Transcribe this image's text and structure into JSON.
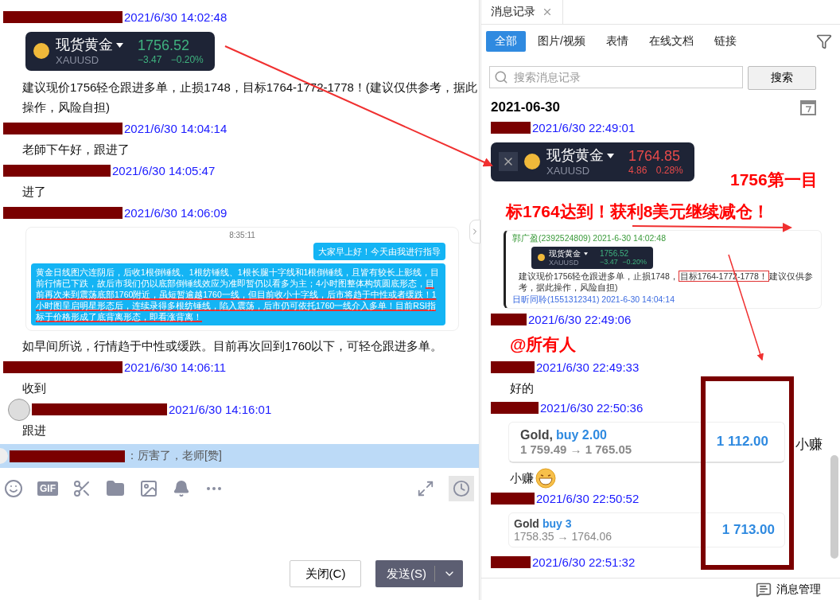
{
  "chat": {
    "messages": [
      {
        "time": "2021/6/30 14:02:48",
        "avatar": false,
        "parts": [
          {
            "kind": "ticker",
            "name": "现货黄金",
            "symbol": "XAUUSD",
            "price": "1756.52",
            "change": "−3.47",
            "percent": "−0.20%",
            "rising": false,
            "closable": false
          },
          {
            "kind": "text",
            "text": "建议现价1756轻仓跟进多单，止损1748，目标1764-1772-1778！(建议仅供参考，据此操作，风险自担)"
          }
        ]
      },
      {
        "time": "2021/6/30 14:04:14",
        "avatar": false,
        "parts": [
          {
            "kind": "text",
            "text": "老師下午好，跟进了"
          }
        ]
      },
      {
        "time": "2021/6/30 14:05:47",
        "avatar": false,
        "parts": [
          {
            "kind": "text",
            "text": "进了"
          }
        ]
      },
      {
        "time": "2021/6/30 14:06:09",
        "avatar": false,
        "parts": [
          {
            "kind": "chat-shot",
            "time": "8:35:11",
            "bubbles": [
              {
                "outgoing": true,
                "text": "大家早上好！今天由我进行指导"
              },
              {
                "outgoing": false,
                "text": "黄金日线图六连阴后，后收1根倒锤线、1根纺锤线、1根长腿十字线和1根倒锤线，且皆有较长上影线，目前行情已下跌，故后市我们仍以底部倒锤线效应为准即暂仍以看多为主；4小时图整体构筑圆底形态，",
                "underlined": "目前再次来到震荡底部1760附近，虽短暂逾越1760一线，但目前收小十字线，后市将趋于中性或者缓跌！1小时图呈启明星形态后，连续录得多根纺锤线，陷入震荡，后市仍可依托1760一线介入多单！目前RSI指标于价格形成了底背离形态，即看涨背离！"
              }
            ]
          },
          {
            "kind": "text",
            "text": "如早间所说，行情趋于中性或缓跌。目前再次回到1760以下，可轻仓跟进多单。"
          }
        ]
      },
      {
        "time": "2021/6/30 14:06:11",
        "avatar": false,
        "parts": [
          {
            "kind": "text",
            "text": "收到"
          }
        ]
      },
      {
        "time": "2021/6/30 14:16:01",
        "avatar": true,
        "parts": [
          {
            "kind": "text",
            "text": "跟进"
          }
        ]
      }
    ]
  },
  "quote": {
    "text": "：厉害了，老师[赞]"
  },
  "toolbar": {
    "gif_label": "GIF",
    "history_selected": true
  },
  "buttons": {
    "close": "关闭(C)",
    "send": "发送(S)"
  },
  "history": {
    "tab": "消息记录",
    "filters": [
      {
        "label": "全部",
        "selected": true
      },
      {
        "label": "图片/视频",
        "selected": false
      },
      {
        "label": "表情",
        "selected": false
      },
      {
        "label": "在线文档",
        "selected": false
      },
      {
        "label": "链接",
        "selected": false
      }
    ],
    "search": {
      "placeholder": "搜索消息记录",
      "button": "搜索"
    },
    "date": "2021-06-30",
    "messages": [
      {
        "time": "2021/6/30 22:49:01",
        "parts": [
          {
            "kind": "ticker",
            "name": "现货黄金",
            "symbol": "XAUUSD",
            "price": "1764.85",
            "change": "4.86",
            "percent": "0.28%",
            "rising": true,
            "closable": true
          },
          {
            "kind": "quote-shot",
            "sender": "郭广盈(2392524809) 2021-6-30 14:02:48",
            "ticker": {
              "name": "现货黄金",
              "symbol": "XAUUSD",
              "price": "1756.52",
              "change": "−3.47",
              "percent": "−0.20%",
              "rising": false
            },
            "before": "建议现价1756轻仓跟进多单，止损1748，",
            "boxed": "目标1764-1772-1778！",
            "after": "建议仅供参考，据此操作，风险自担)",
            "next": "日昕同聆(1551312341) 2021-6-30 14:04:14"
          }
        ]
      },
      {
        "time": "2021/6/30 22:49:06",
        "parts": [
          {
            "kind": "mention",
            "text": "@所有人"
          }
        ]
      },
      {
        "time": "2021/6/30 22:49:33",
        "parts": [
          {
            "kind": "text",
            "text": "好的"
          }
        ]
      },
      {
        "time": "2021/6/30 22:50:36",
        "parts": [
          {
            "kind": "trade",
            "compact": false,
            "instrument": "Gold,",
            "side": "buy 2.00",
            "prices": "1 759.49 → 1 765.05",
            "profit": "1 112.00"
          },
          {
            "kind": "text",
            "text": "小赚",
            "emoji": true
          }
        ]
      },
      {
        "time": "2021/6/30 22:50:52",
        "parts": [
          {
            "kind": "trade",
            "compact": true,
            "instrument": "Gold",
            "side": "buy 3",
            "prices": "1758.35 → 1764.06",
            "profit": "1 713.00"
          }
        ]
      },
      {
        "time": "2021/6/30 22:51:32"
      }
    ],
    "footer": "消息管理"
  },
  "annotations": {
    "texts": [
      "1756第一目",
      "标1764达到！获利8美元继续减仓！"
    ],
    "side_note": "小赚"
  }
}
